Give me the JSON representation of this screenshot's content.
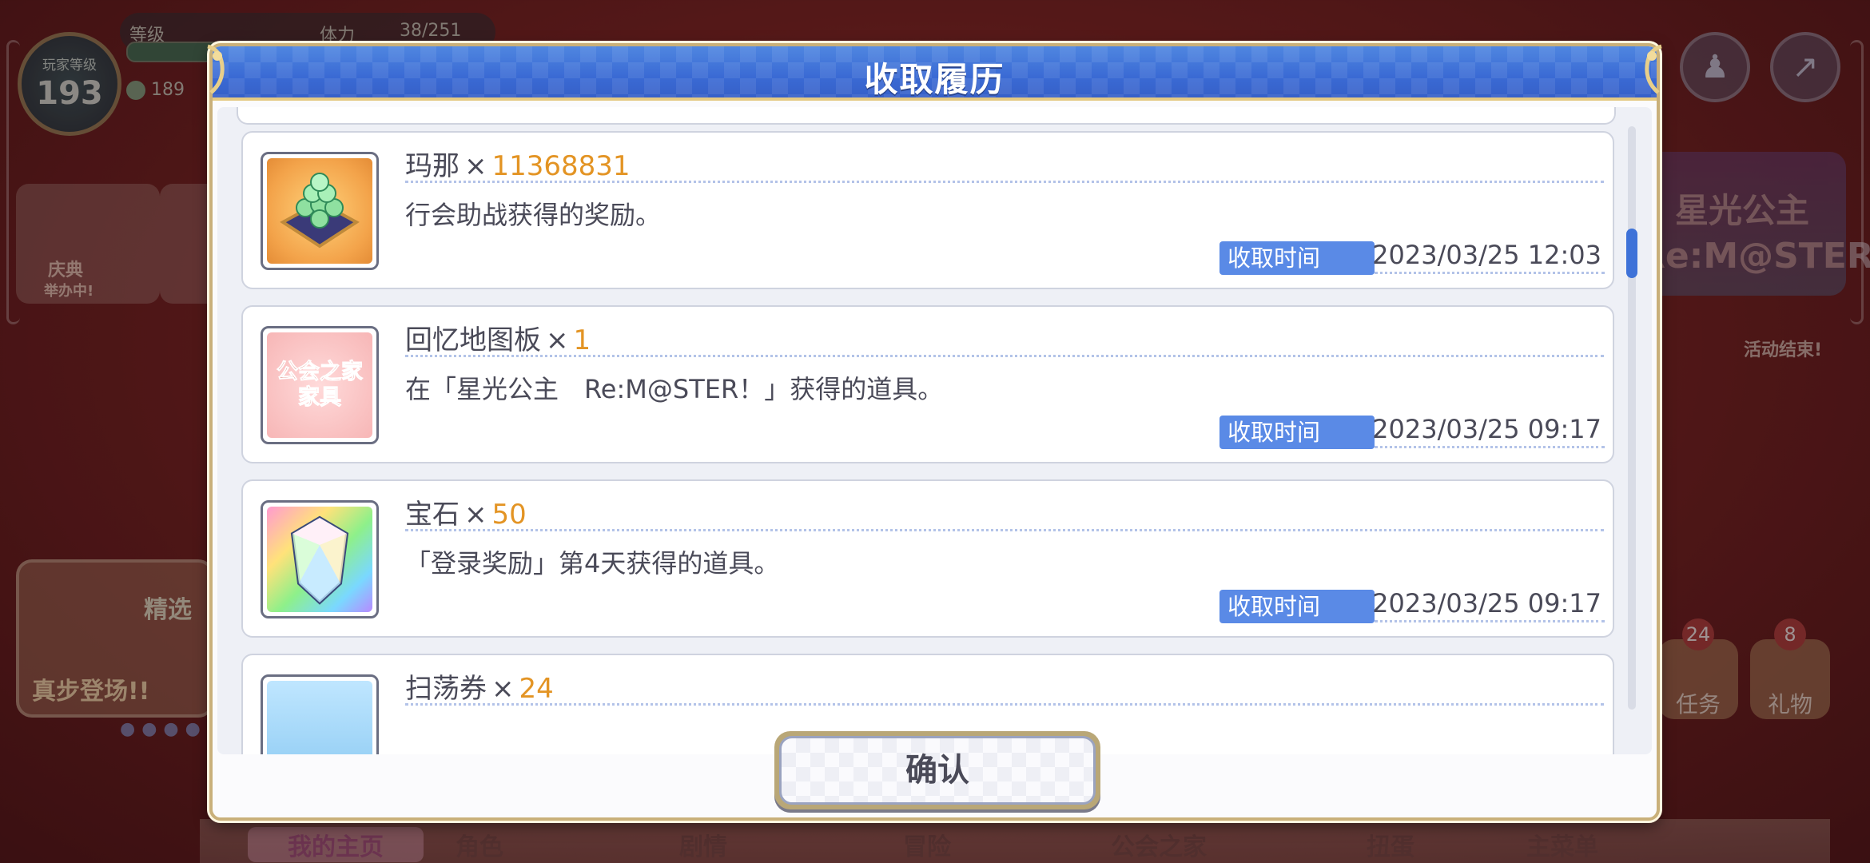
{
  "background": {
    "player_level_label": "玩家等级",
    "player_level": "193",
    "top_bar_left": "等级",
    "top_bar_stamina_label": "体力",
    "top_bar_stamina": "38/251",
    "gold": "189",
    "left_event_label": "庆典",
    "left_event_sub": "举办中!",
    "banner_title": "精选",
    "banner_subtitle": "真步登场!!",
    "event_logo_line1": "星光公主",
    "event_logo_line2": "Re:M@STER",
    "event_end_text": "活动结束!",
    "gift_badge_1": "24",
    "gift_badge_2": "8",
    "gift_label_1": "任务",
    "gift_label_2": "礼物",
    "nav": [
      "我的主页",
      "角色",
      "剧情",
      "冒险",
      "公会之家",
      "扭蛋",
      "主菜单"
    ]
  },
  "modal": {
    "title": "收取履历",
    "time_label": "收取时间",
    "confirm_label": "确认",
    "items": [
      {
        "name": "玛那",
        "qty": "11368831",
        "desc": "行会助战获得的奖励。",
        "time": "2023/03/25  12:03",
        "icon": "mana-coins-icon"
      },
      {
        "name": "回忆地图板",
        "qty": "1",
        "desc": "在「星光公主　Re:M@STER！」获得的道具。",
        "time": "2023/03/25  09:17",
        "icon": "guild-house-furniture-icon",
        "icon_text_1": "公会之家",
        "icon_text_2": "家具"
      },
      {
        "name": "宝石",
        "qty": "50",
        "desc": "「登录奖励」第4天获得的道具。",
        "time": "2023/03/25  09:17",
        "icon": "jewel-icon"
      },
      {
        "name": "扫荡券",
        "qty": "24",
        "icon": "skip-ticket-icon"
      }
    ]
  },
  "colors": {
    "header_blue": "#3a6ad4",
    "qty_orange": "#e39424",
    "time_label_bg": "#5a8ae6",
    "frame_gold": "#c9b07a"
  }
}
